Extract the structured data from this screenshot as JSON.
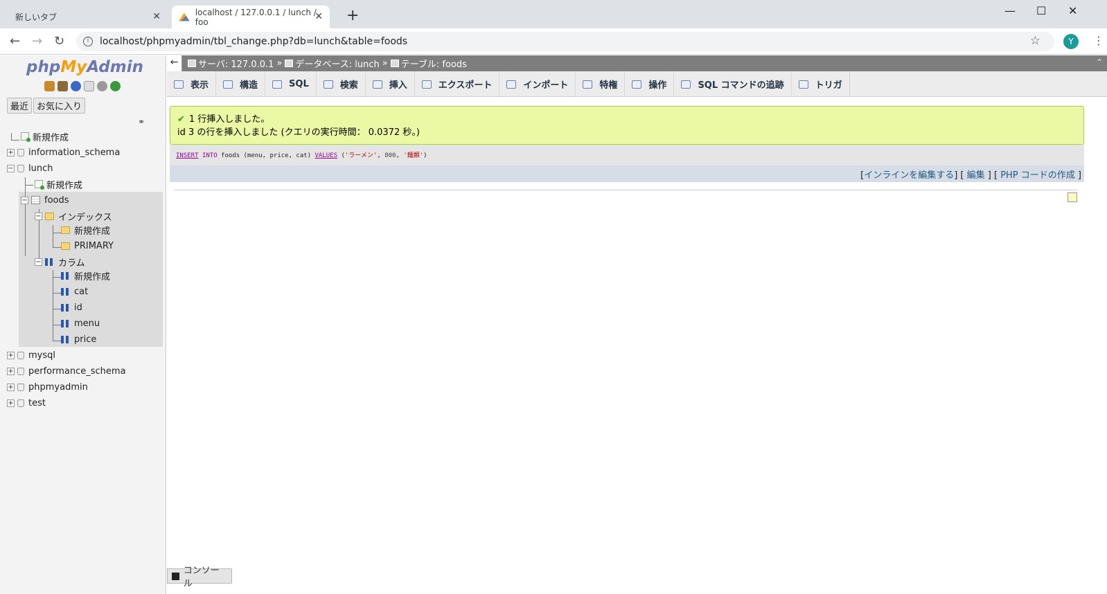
{
  "browser": {
    "tabs": [
      {
        "label": "新しいタブ",
        "active": false
      },
      {
        "label": "localhost / 127.0.0.1 / lunch / foo",
        "active": true
      }
    ],
    "url": "localhost/phpmyadmin/tbl_change.php?db=lunch&table=foods",
    "avatar_letter": "Y"
  },
  "sidebar": {
    "logo": {
      "php": "php",
      "my": "My",
      "admin": "Admin"
    },
    "recent_label": "最近",
    "favorites_label": "お気に入り",
    "tree": {
      "new": "新規作成",
      "information_schema": "information_schema",
      "lunch": "lunch",
      "lunch_new": "新規作成",
      "foods": "foods",
      "indexes": "インデックス",
      "index_new": "新規作成",
      "primary": "PRIMARY",
      "columns": "カラム",
      "column_new": "新規作成",
      "col_cat": "cat",
      "col_id": "id",
      "col_menu": "menu",
      "col_price": "price",
      "mysql": "mysql",
      "performance_schema": "performance_schema",
      "phpmyadmin": "phpmyadmin",
      "test": "test"
    }
  },
  "breadcrumb": {
    "server": "サーバ: 127.0.0.1",
    "database": "データベース: lunch",
    "table": "テーブル: foods",
    "sep": "»"
  },
  "tabs": [
    "表示",
    "構造",
    "SQL",
    "検索",
    "挿入",
    "エクスポート",
    "インポート",
    "特権",
    "操作",
    "SQL コマンドの追跡",
    "トリガ"
  ],
  "message": {
    "line1": "1 行挿入しました。",
    "line2": "id 3 の行を挿入しました (クエリの実行時間： 0.0372 秒。)"
  },
  "sql": {
    "insert": "INSERT",
    "into": "INTO",
    "rest": " foods (menu, price, cat) ",
    "values": "VALUES",
    "open": " (",
    "v1": "'ラーメン'",
    "comma1": ", ",
    "v2": "800",
    "comma2": ", ",
    "v3": "'麺類'",
    "close": ")"
  },
  "sql_links": {
    "inline_edit": "インラインを編集する",
    "edit": "編集",
    "php_code": "PHP コードの作成"
  },
  "console_label": "コンソール"
}
